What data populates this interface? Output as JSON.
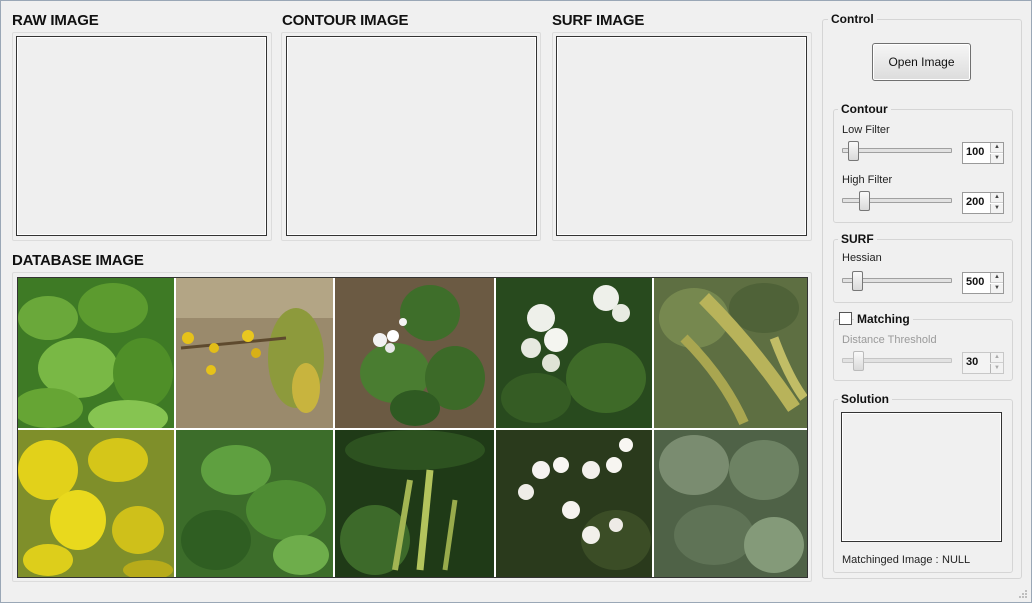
{
  "sections": {
    "raw": "RAW IMAGE",
    "contour": "CONTOUR IMAGE",
    "surf": "SURF IMAGE",
    "database": "DATABASE IMAGE"
  },
  "control": {
    "title": "Control",
    "open_button": "Open Image",
    "contour": {
      "title": "Contour",
      "low_label": "Low Filter",
      "low_value": "100",
      "low_level": 0.1,
      "high_label": "High Filter",
      "high_value": "200",
      "high_level": 0.2
    },
    "surf": {
      "title": "SURF",
      "hessian_label": "Hessian",
      "hessian_value": "500",
      "hessian_level": 0.14
    },
    "matching": {
      "title": "Matching",
      "checked": false,
      "threshold_label": "Distance Threshold",
      "threshold_value": "30",
      "threshold_level": 0.15
    },
    "solution": {
      "title": "Solution",
      "matched_label": "Matchinged Image :",
      "matched_value": "NULL"
    }
  },
  "database_images": [
    "plant-green-leaves",
    "plant-yellow-buds",
    "plant-white-flower-nettle",
    "plant-white-flower-cluster",
    "plant-seed-spikes",
    "plant-yellow-goldenrod",
    "plant-maple-leaves",
    "plant-green-spikes",
    "plant-white-aster",
    "plant-leafy-shrub"
  ]
}
